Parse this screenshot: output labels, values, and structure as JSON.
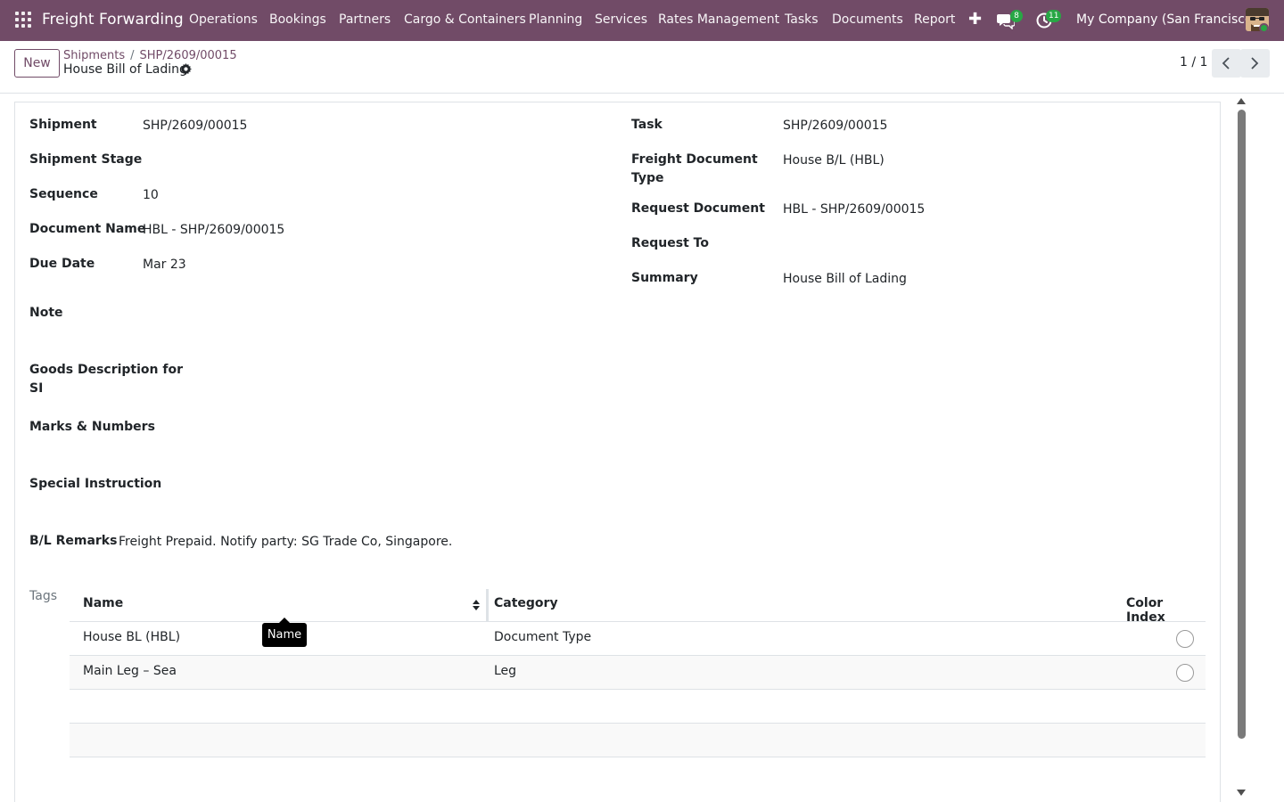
{
  "nav": {
    "brand": "Freight Forwarding",
    "menu": [
      "Operations",
      "Bookings",
      "Partners",
      "Cargo & Containers",
      "Planning",
      "Services",
      "Rates Management",
      "Tasks",
      "Documents",
      "Report"
    ],
    "plus": "✚",
    "messages_count": "8",
    "activities_count": "11",
    "company": "My Company (San Francisco)",
    "accent_color": "#714b67",
    "badge_color": "#28a745"
  },
  "control": {
    "new_label": "New",
    "breadcrumb_parent": "Shipments",
    "breadcrumb_record": "SHP/2609/00015",
    "separator": "/",
    "title": "House Bill of Lading",
    "pager": "1 / 1"
  },
  "form": {
    "shipment_label": "Shipment",
    "shipment_value": "SHP/2609/00015",
    "shipment_stage_label": "Shipment Stage",
    "shipment_stage_value": "",
    "sequence_label": "Sequence",
    "sequence_value": "10",
    "document_name_label": "Document Name",
    "document_name_value": "HBL - SHP/2609/00015",
    "due_date_label": "Due Date",
    "due_date_value": "Mar 23",
    "task_label": "Task",
    "task_value": "SHP/2609/00015",
    "freight_doc_type_label_1": "Freight Document",
    "freight_doc_type_label_2": "Type",
    "freight_doc_type_value": "House B/L (HBL)",
    "request_document_label": "Request Document",
    "request_document_value": "HBL - SHP/2609/00015",
    "request_to_label": "Request To",
    "request_to_value": "",
    "summary_label": "Summary",
    "summary_value": "House Bill of Lading",
    "note_label": "Note",
    "goods_desc_label_1": "Goods Description for",
    "goods_desc_label_2": "SI",
    "marks_label": "Marks & Numbers",
    "special_instruction_label": "Special Instruction",
    "bl_remarks_label": "B/L Remarks",
    "bl_remarks_value": "Freight Prepaid. Notify party: SG Trade Co, Singapore."
  },
  "tags": {
    "label": "Tags",
    "columns": [
      "Name",
      "Category",
      "Color Index"
    ],
    "rows": [
      {
        "name": "House BL (HBL)",
        "category": "Document Type"
      },
      {
        "name": "Main Leg – Sea",
        "category": "Leg"
      }
    ],
    "tooltip": "Name"
  }
}
